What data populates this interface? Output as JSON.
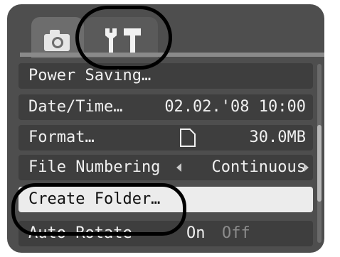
{
  "tabs": [
    {
      "name": "camera",
      "icon": "camera-icon"
    },
    {
      "name": "settings",
      "icon": "wrench-hammer-icon",
      "active": true
    }
  ],
  "menu": {
    "items": [
      {
        "label": "Power Saving…",
        "value": ""
      },
      {
        "label": "Date/Time…",
        "value": "02.02.'08 10:00"
      },
      {
        "label": "Format…",
        "value": "30.0MB"
      },
      {
        "label": "File Numbering",
        "value": "Continuous"
      },
      {
        "label": "Create Folder…",
        "value": "",
        "selected": true
      },
      {
        "label": "Auto Rotate",
        "value_on": "On",
        "value_off": "Off"
      }
    ]
  },
  "colors": {
    "screen_bg": "#4e4e4e",
    "row_bg": "#3e3e3e",
    "selected_row_bg": "#ececec",
    "highlight_circle": "#000000"
  }
}
